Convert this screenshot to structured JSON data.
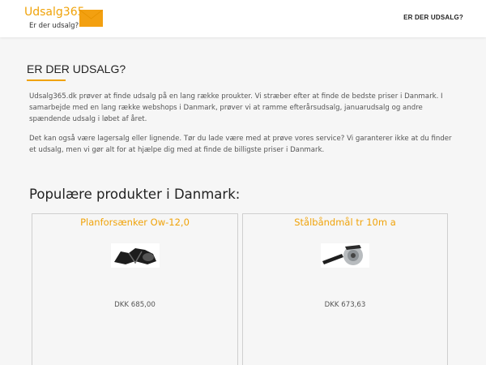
{
  "header": {
    "logo_title": "Udsalg365",
    "logo_subtitle": "Er der udsalg?",
    "logo_icon": "envelope-icon",
    "nav_link": "ER DER UDSALG?"
  },
  "intro": {
    "title": "ER DER UDSALG?",
    "paragraph1": "Udsalg365.dk prøver at finde udsalg på en lang række proukter. Vi stræber efter at finde de bedste priser i Danmark. I samarbejde med en lang række webshops i Danmark, prøver vi at ramme efterårsudsalg, januarudsalg og andre spændende udsalg i løbet af året.",
    "paragraph2": "Det kan også være lagersalg eller lignende. Tør du lade være med at prøve vores service? Vi garanterer ikke at du finder et udsalg, men vi gør alt for at hjælpe dig med at finde de billigste priser i Danmark."
  },
  "products": {
    "heading": "Populære produkter i Danmark:",
    "items": [
      {
        "title": "Planforsænker Ow-12,0",
        "price": "DKK 685,00",
        "image": "planforsaenker-image"
      },
      {
        "title": "Stålbåndmål tr 10m a",
        "price": "DKK 673,63",
        "image": "tape-measure-image"
      }
    ]
  },
  "colors": {
    "accent": "#f0a30a",
    "background": "#f6f6f6",
    "header_bg": "#ffffff"
  }
}
